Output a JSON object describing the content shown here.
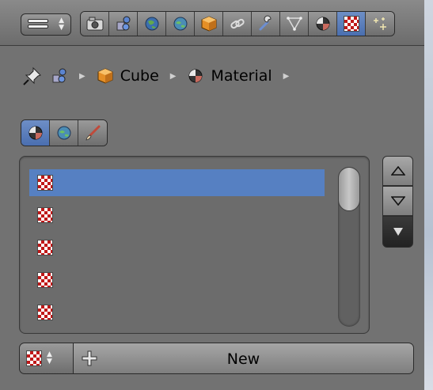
{
  "header": {
    "editor_type_icon": "properties-editor-icon",
    "context_tabs": [
      {
        "icon": "render-camera-icon",
        "active": false
      },
      {
        "icon": "render-layers-icon",
        "active": false
      },
      {
        "icon": "scene-icon",
        "active": false
      },
      {
        "icon": "world-icon",
        "active": false
      },
      {
        "icon": "object-cube-icon",
        "active": false
      },
      {
        "icon": "constraints-link-icon",
        "active": false
      },
      {
        "icon": "modifiers-wrench-icon",
        "active": false
      },
      {
        "icon": "mesh-data-icon",
        "active": false
      },
      {
        "icon": "material-sphere-icon",
        "active": false
      },
      {
        "icon": "texture-checker-icon",
        "active": true
      },
      {
        "icon": "particles-icon",
        "active": false
      }
    ]
  },
  "breadcrumb": {
    "items": [
      {
        "icon": "pin-icon",
        "label": ""
      },
      {
        "icon": "scene-icon",
        "label": ""
      },
      {
        "icon": "object-cube-icon",
        "label": "Cube"
      },
      {
        "icon": "material-sphere-icon",
        "label": "Material"
      }
    ]
  },
  "texture_context": {
    "buttons": [
      {
        "icon": "material-sphere-icon",
        "active": true
      },
      {
        "icon": "world-icon",
        "active": false
      },
      {
        "icon": "brush-icon",
        "active": false
      }
    ]
  },
  "slots": [
    {
      "icon": "texture-checker-icon",
      "label": "",
      "selected": true
    },
    {
      "icon": "texture-checker-icon",
      "label": "",
      "selected": false
    },
    {
      "icon": "texture-checker-icon",
      "label": "",
      "selected": false
    },
    {
      "icon": "texture-checker-icon",
      "label": "",
      "selected": false
    },
    {
      "icon": "texture-checker-icon",
      "label": "",
      "selected": false
    }
  ],
  "new_texture": {
    "label": "New"
  },
  "colors": {
    "panel_bg": "#727272",
    "selected_row": "#5680c2",
    "active_tab": "#5a7fc0"
  }
}
